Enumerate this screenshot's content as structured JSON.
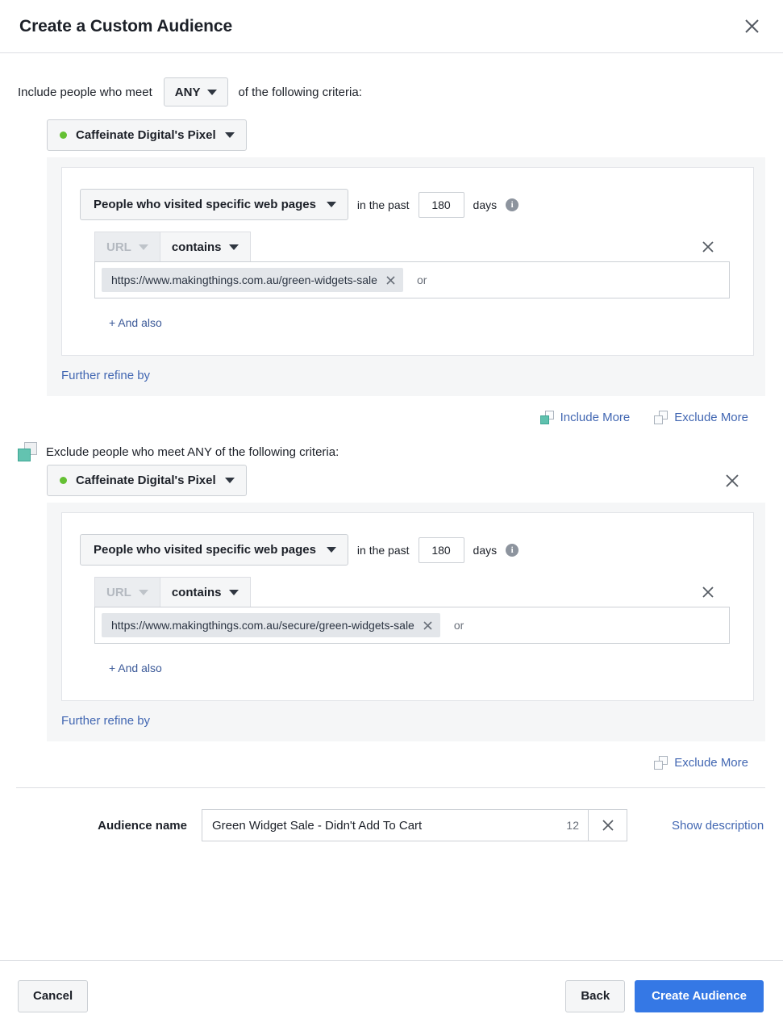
{
  "header": {
    "title": "Create a Custom Audience",
    "close_icon": "close-icon"
  },
  "include_section": {
    "intro_prefix": "Include people who meet",
    "match_operator": "ANY",
    "intro_suffix": "of the following criteria:",
    "pixel_name": "Caffeinate Digital's Pixel",
    "pixel_status_color": "#64c033",
    "event_label": "People who visited specific web pages",
    "in_the_past_label": "in the past",
    "days_value": "180",
    "days_label": "days",
    "info_icon": "info-icon",
    "field_label": "URL",
    "operator_label": "contains",
    "url_token": "https://www.makingthings.com.au/green-widgets-sale",
    "or_label": "or",
    "and_also_label": "+ And also",
    "further_refine_label": "Further refine by"
  },
  "more_links": {
    "include_more": "Include More",
    "exclude_more": "Exclude More"
  },
  "exclude_section": {
    "header_text": "Exclude people who meet ANY of the following criteria:",
    "pixel_name": "Caffeinate Digital's Pixel",
    "pixel_status_color": "#64c033",
    "event_label": "People who visited specific web pages",
    "in_the_past_label": "in the past",
    "days_value": "180",
    "days_label": "days",
    "info_icon": "info-icon",
    "field_label": "URL",
    "operator_label": "contains",
    "url_token": "https://www.makingthings.com.au/secure/green-widgets-sale",
    "or_label": "or",
    "and_also_label": "+ And also",
    "further_refine_label": "Further refine by",
    "exclude_more": "Exclude More"
  },
  "audience_name": {
    "label": "Audience name",
    "value": "Green Widget Sale - Didn't Add To Cart",
    "char_count": "12",
    "show_description_label": "Show description"
  },
  "footer": {
    "cancel_label": "Cancel",
    "back_label": "Back",
    "create_label": "Create Audience",
    "primary_color": "#3578e5"
  }
}
